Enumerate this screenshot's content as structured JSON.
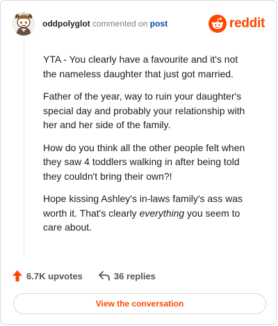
{
  "header": {
    "username": "oddpolyglot",
    "action_text": "commented on",
    "post_link": "post",
    "logo_text": "reddit",
    "avatar_icon": "snoo-avatar-icon"
  },
  "comment": {
    "paragraphs": [
      "YTA - You clearly have a favourite and it's not the nameless daughter that just got married.",
      "Father of the year, way to ruin your daughter's special day and probably your relationship with her and her side of the family.",
      "How do you think all the other people felt when they saw 4 toddlers walking in after being told they couldn't bring their own?!"
    ],
    "last_paragraph": {
      "before": "Hope kissing Ashley's in-laws family's ass was worth it. That's clearly ",
      "emphasis": "everything",
      "after": " you seem to care about."
    }
  },
  "actions": {
    "upvotes": "6.7K upvotes",
    "replies": "36 replies",
    "upvote_icon": "upvote-arrow-icon",
    "reply_icon": "reply-arrow-icon"
  },
  "view_button": "View the conversation",
  "colors": {
    "brand": "#ff4500",
    "link": "#0045ac",
    "muted": "#7c7c7c"
  }
}
